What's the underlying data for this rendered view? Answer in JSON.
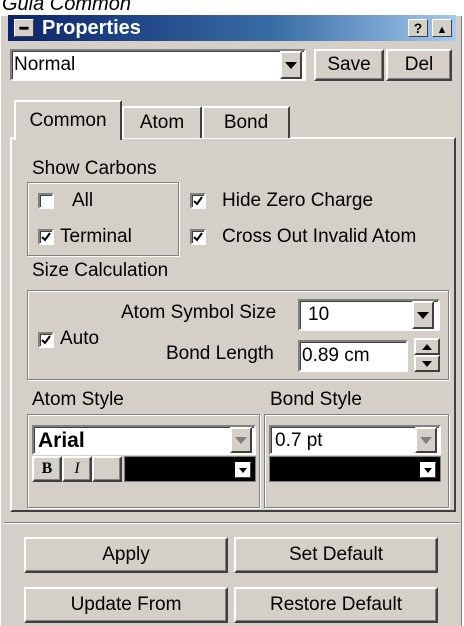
{
  "caption": "Gula Common",
  "window": {
    "title": "Properties",
    "help_label": "?",
    "collapse_label": "▲"
  },
  "style_select": {
    "value": "Normal",
    "save_label": "Save",
    "del_label": "Del"
  },
  "tabs": [
    {
      "label": "Common",
      "active": true
    },
    {
      "label": "Atom",
      "active": false
    },
    {
      "label": "Bond",
      "active": false
    }
  ],
  "show_carbons": {
    "label": "Show Carbons",
    "all": {
      "label": "All",
      "checked": false
    },
    "terminal": {
      "label": "Terminal",
      "checked": true
    },
    "hide_zero_charge": {
      "label": "Hide Zero Charge",
      "checked": true
    },
    "cross_out_invalid": {
      "label": "Cross Out Invalid Atom",
      "checked": true
    }
  },
  "size_calculation": {
    "label": "Size Calculation",
    "auto": {
      "label": "Auto",
      "checked": true
    },
    "atom_symbol_size": {
      "label": "Atom Symbol Size",
      "value": "10"
    },
    "bond_length": {
      "label": "Bond Length",
      "value": "0.89 cm"
    }
  },
  "atom_style": {
    "label": "Atom Style",
    "font": "Arial",
    "bold_label": "B",
    "italic_label": "I",
    "color": "#000000"
  },
  "bond_style": {
    "label": "Bond Style",
    "width": "0.7 pt",
    "color": "#000000"
  },
  "buttons": {
    "apply": "Apply",
    "set_default": "Set Default",
    "update_from": "Update From",
    "restore_default": "Restore Default"
  }
}
